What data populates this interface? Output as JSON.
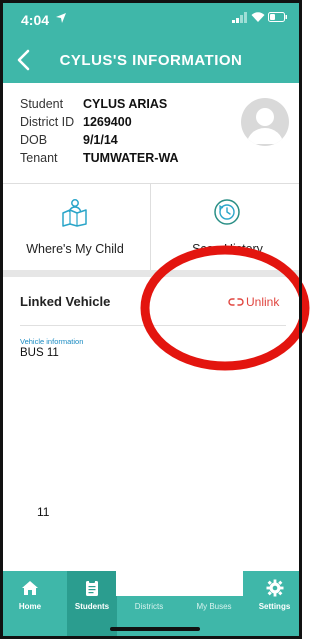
{
  "status_bar": {
    "time": "4:04"
  },
  "nav": {
    "title": "CYLUS'S INFORMATION"
  },
  "student": {
    "fields": [
      {
        "label": "Student",
        "value": "CYLUS ARIAS"
      },
      {
        "label": "District ID",
        "value": "1269400"
      },
      {
        "label": "DOB",
        "value": "9/1/14"
      },
      {
        "label": "Tenant",
        "value": "TUMWATER-WA"
      }
    ]
  },
  "actions": [
    {
      "label": "Where's My Child",
      "icon": "map-person-icon"
    },
    {
      "label": "Scan History",
      "icon": "history-clock-icon"
    }
  ],
  "linked_vehicle": {
    "title": "Linked Vehicle",
    "unlink_label": "Unlink",
    "info_label": "Vehicle information",
    "value": "BUS 11"
  },
  "stray_text": "11",
  "tabs": [
    {
      "label": "Home",
      "icon": "home-icon",
      "active": false
    },
    {
      "label": "Students",
      "icon": "clipboard-icon",
      "active": true
    },
    {
      "label": "Districts",
      "icon": "",
      "active": false
    },
    {
      "label": "My Buses",
      "icon": "",
      "active": false
    },
    {
      "label": "Settings",
      "icon": "gear-icon",
      "active": false
    }
  ],
  "colors": {
    "header_teal": "#3fb7a9",
    "active_tab": "#2b9d8f",
    "unlink_red": "#e0453f",
    "link_blue": "#1a8bc2",
    "annotation_red": "#e3150f"
  }
}
